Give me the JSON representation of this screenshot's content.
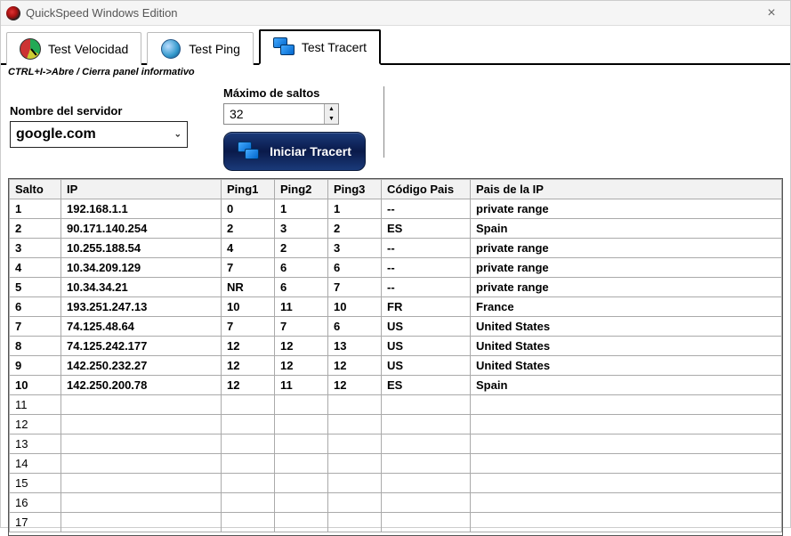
{
  "window": {
    "title": "QuickSpeed Windows Edition",
    "close_glyph": "×"
  },
  "tabs": {
    "velocidad": "Test Velocidad",
    "ping": "Test Ping",
    "tracert": "Test Tracert"
  },
  "hint": "CTRL+I->Abre / Cierra panel informativo",
  "controls": {
    "server_label": "Nombre del servidor",
    "server_value": "google.com",
    "hops_label": "Máximo de saltos",
    "hops_value": "32",
    "start_label": "Iniciar Tracert"
  },
  "table": {
    "headers": {
      "salto": "Salto",
      "ip": "IP",
      "ping1": "Ping1",
      "ping2": "Ping2",
      "ping3": "Ping3",
      "codigo": "Código Pais",
      "pais": "Pais de la IP"
    },
    "rows": [
      {
        "salto": "1",
        "ip": "192.168.1.1",
        "p1": "0",
        "p2": "1",
        "p3": "1",
        "cod": "--",
        "pais": "private range"
      },
      {
        "salto": "2",
        "ip": "90.171.140.254",
        "p1": "2",
        "p2": "3",
        "p3": "2",
        "cod": "ES",
        "pais": "Spain"
      },
      {
        "salto": "3",
        "ip": "10.255.188.54",
        "p1": "4",
        "p2": "2",
        "p3": "3",
        "cod": "--",
        "pais": "private range"
      },
      {
        "salto": "4",
        "ip": "10.34.209.129",
        "p1": "7",
        "p2": "6",
        "p3": "6",
        "cod": "--",
        "pais": "private range"
      },
      {
        "salto": "5",
        "ip": "10.34.34.21",
        "p1": "NR",
        "p2": "6",
        "p3": "7",
        "cod": "--",
        "pais": "private range"
      },
      {
        "salto": "6",
        "ip": "193.251.247.13",
        "p1": "10",
        "p2": "11",
        "p3": "10",
        "cod": "FR",
        "pais": "France"
      },
      {
        "salto": "7",
        "ip": "74.125.48.64",
        "p1": "7",
        "p2": "7",
        "p3": "6",
        "cod": "US",
        "pais": "United States"
      },
      {
        "salto": "8",
        "ip": "74.125.242.177",
        "p1": "12",
        "p2": "12",
        "p3": "13",
        "cod": "US",
        "pais": "United States"
      },
      {
        "salto": "9",
        "ip": "142.250.232.27",
        "p1": "12",
        "p2": "12",
        "p3": "12",
        "cod": "US",
        "pais": "United States"
      },
      {
        "salto": "10",
        "ip": "142.250.200.78",
        "p1": "12",
        "p2": "11",
        "p3": "12",
        "cod": "ES",
        "pais": "Spain"
      },
      {
        "salto": "11",
        "ip": "",
        "p1": "",
        "p2": "",
        "p3": "",
        "cod": "",
        "pais": ""
      },
      {
        "salto": "12",
        "ip": "",
        "p1": "",
        "p2": "",
        "p3": "",
        "cod": "",
        "pais": ""
      },
      {
        "salto": "13",
        "ip": "",
        "p1": "",
        "p2": "",
        "p3": "",
        "cod": "",
        "pais": ""
      },
      {
        "salto": "14",
        "ip": "",
        "p1": "",
        "p2": "",
        "p3": "",
        "cod": "",
        "pais": ""
      },
      {
        "salto": "15",
        "ip": "",
        "p1": "",
        "p2": "",
        "p3": "",
        "cod": "",
        "pais": ""
      },
      {
        "salto": "16",
        "ip": "",
        "p1": "",
        "p2": "",
        "p3": "",
        "cod": "",
        "pais": ""
      },
      {
        "salto": "17",
        "ip": "",
        "p1": "",
        "p2": "",
        "p3": "",
        "cod": "",
        "pais": ""
      }
    ]
  }
}
